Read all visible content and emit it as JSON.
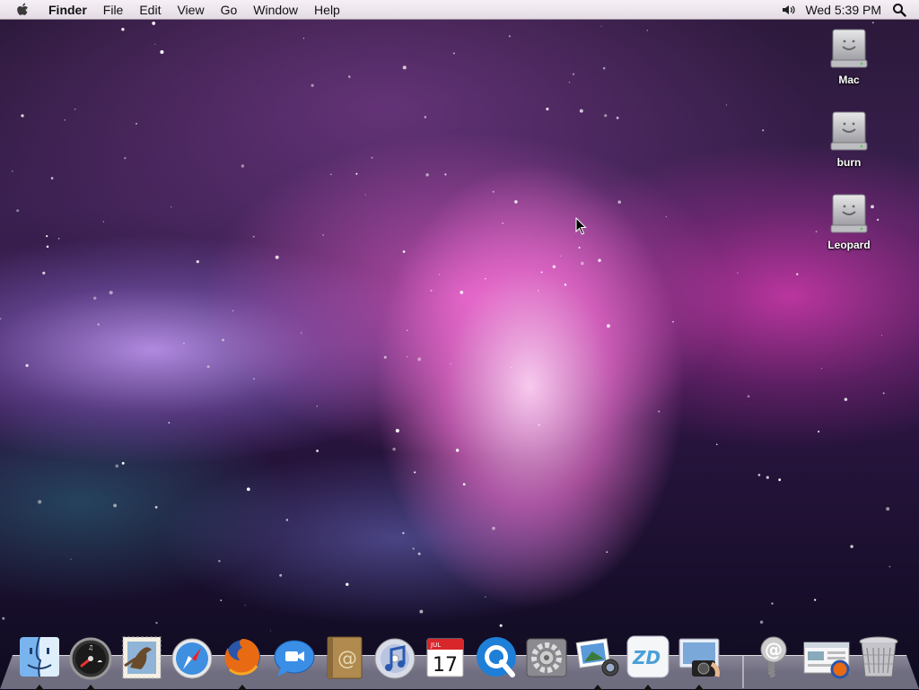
{
  "menubar": {
    "apple_icon": "apple-icon",
    "app_name": "Finder",
    "menus": [
      "File",
      "Edit",
      "View",
      "Go",
      "Window",
      "Help"
    ],
    "volume_icon": "speaker-icon",
    "clock": "Wed 5:39 PM",
    "spotlight_icon": "magnifier-icon"
  },
  "desktop": {
    "icons": [
      {
        "label": "Mac",
        "icon": "hard-drive-icon"
      },
      {
        "label": "burn",
        "icon": "hard-drive-icon"
      },
      {
        "label": "Leopard",
        "icon": "hard-drive-icon"
      }
    ]
  },
  "dock": {
    "apps": [
      {
        "name": "Finder",
        "icon": "finder-icon",
        "running": true
      },
      {
        "name": "Dashboard",
        "icon": "dashboard-icon",
        "running": true
      },
      {
        "name": "Mail",
        "icon": "mail-stamp-icon",
        "running": false
      },
      {
        "name": "Safari",
        "icon": "safari-compass-icon",
        "running": false
      },
      {
        "name": "Firefox",
        "icon": "firefox-icon",
        "running": true
      },
      {
        "name": "iChat",
        "icon": "ichat-bubble-icon",
        "running": false
      },
      {
        "name": "Address Book",
        "icon": "address-book-icon",
        "running": false
      },
      {
        "name": "iTunes",
        "icon": "itunes-cd-icon",
        "running": false
      },
      {
        "name": "iCal",
        "icon": "ical-calendar-icon",
        "running": false,
        "month": "JUL",
        "day": "17"
      },
      {
        "name": "QuickTime",
        "icon": "quicktime-icon",
        "running": false
      },
      {
        "name": "System Preferences",
        "icon": "gear-icon",
        "running": false
      },
      {
        "name": "iPhoto",
        "icon": "iphoto-icon",
        "running": true
      },
      {
        "name": "ZD",
        "icon": "zd-icon",
        "running": true,
        "text": "ZD"
      },
      {
        "name": "Photo Booth",
        "icon": "camera-icon",
        "running": true
      }
    ],
    "stacks": [
      {
        "name": "Mail Stack",
        "icon": "at-spring-icon",
        "text": "@"
      },
      {
        "name": "Downloads",
        "icon": "downloads-stack-icon"
      },
      {
        "name": "Trash",
        "icon": "trash-icon"
      }
    ]
  }
}
